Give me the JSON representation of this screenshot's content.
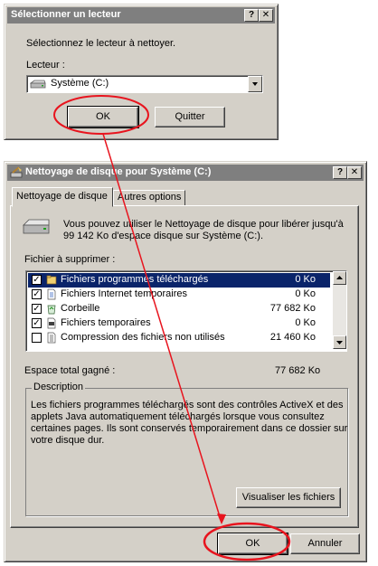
{
  "drive_dialog": {
    "title": "Sélectionner un lecteur",
    "help_glyph": "?",
    "close_glyph": "✕",
    "prompt": "Sélectionnez le lecteur à nettoyer.",
    "drive_label": "Lecteur :",
    "drive_value": "Système (C:)",
    "ok_label": "OK",
    "quit_label": "Quitter"
  },
  "cleanup_dialog": {
    "title": "Nettoyage de disque pour Système (C:)",
    "help_glyph": "?",
    "close_glyph": "✕",
    "tabs": [
      {
        "label": "Nettoyage de disque"
      },
      {
        "label": "Autres options"
      }
    ],
    "intro": [
      "Vous pouvez utiliser le Nettoyage de disque pour libérer jusqu'à",
      "99 142 Ko d'espace disque sur Système (C:)."
    ],
    "files_label": "Fichier à supprimer :",
    "files": [
      {
        "label": "Fichiers programmes téléchargés",
        "size": "0 Ko",
        "checked": true,
        "icon": "folder-icon"
      },
      {
        "label": "Fichiers Internet temporaires",
        "size": "0 Ko",
        "checked": true,
        "icon": "document-icon"
      },
      {
        "label": "Corbeille",
        "size": "77 682 Ko",
        "checked": true,
        "icon": "recycle-bin-icon"
      },
      {
        "label": "Fichiers temporaires",
        "size": "0 Ko",
        "checked": true,
        "icon": "document-icon"
      },
      {
        "label": "Compression des fichiers non utilisés",
        "size": "21 460 Ko",
        "checked": false,
        "icon": "compress-icon"
      }
    ],
    "total_label": "Espace total gagné :",
    "total_value": "77 682 Ko",
    "description_label": "Description",
    "description_lines": [
      "Les fichiers programmes téléchargés sont des contrôles ActiveX et des",
      "applets Java automatiquement téléchargés lorsque vous consultez",
      "certaines pages. Ils sont conservés temporairement dans ce dossier sur",
      "votre disque dur."
    ],
    "view_files_label": "Visualiser les fichiers",
    "ok_label": "OK",
    "cancel_label": "Annuler"
  },
  "colors": {
    "dialog_face": "#d4d0c8",
    "inactive_title": "#7f7f7f",
    "selection": "#0a246a",
    "annotation_red": "#e8141e"
  }
}
